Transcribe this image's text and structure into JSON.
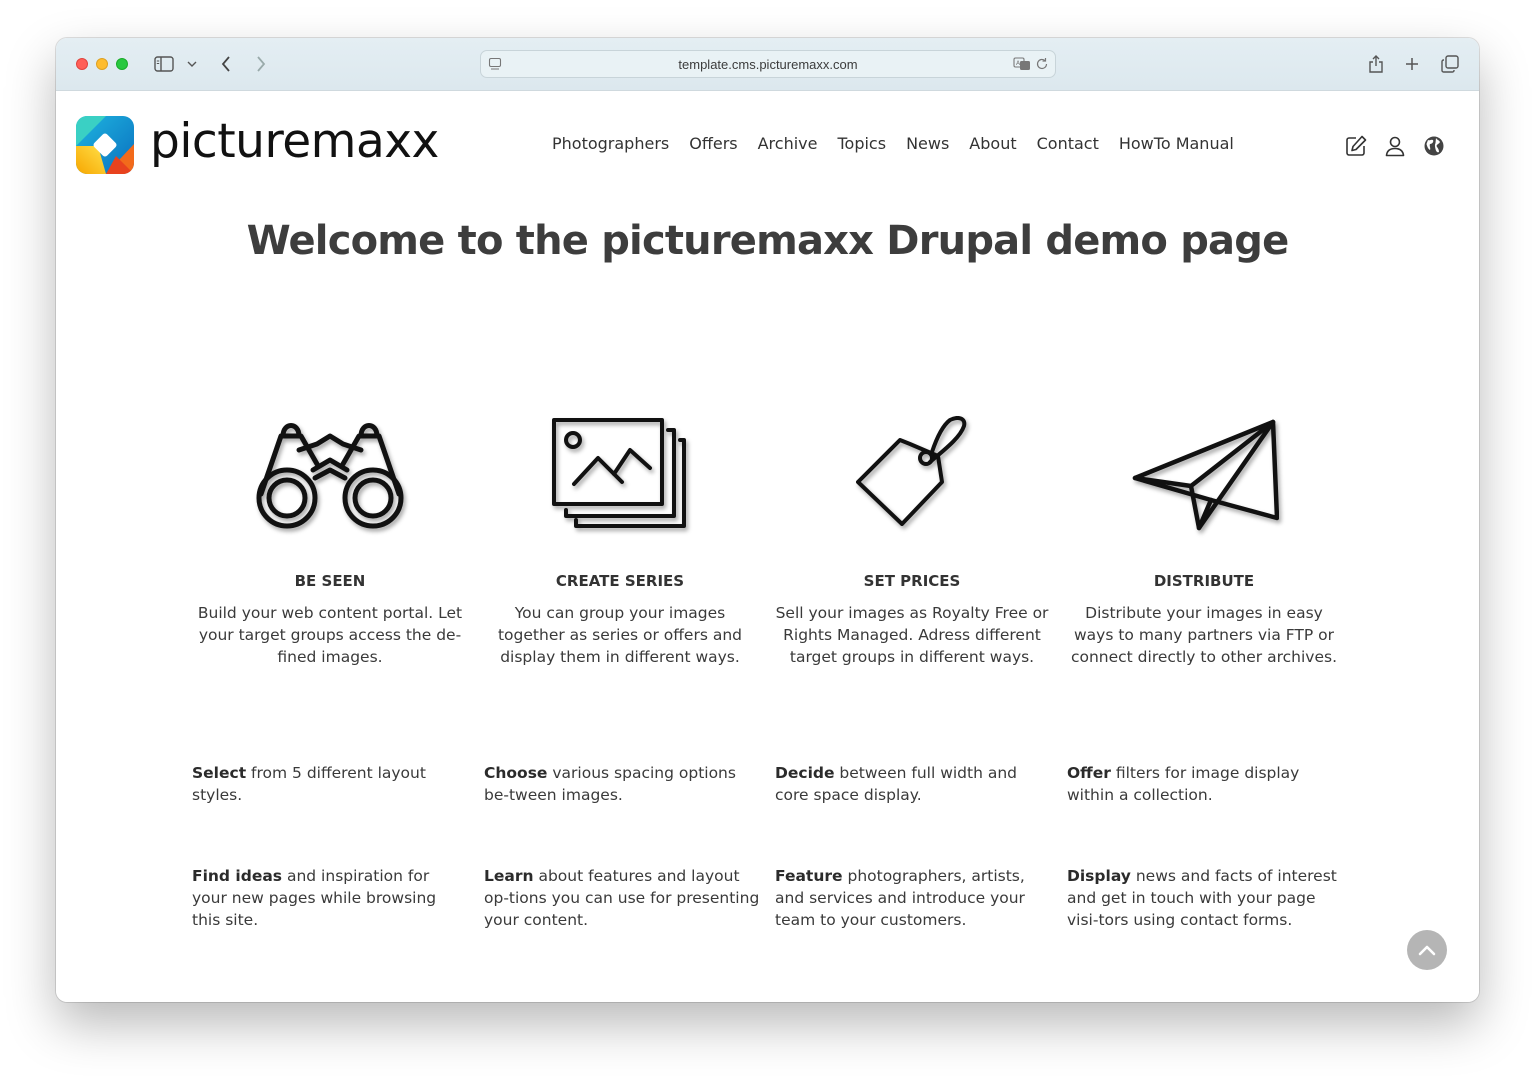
{
  "browser": {
    "url": "template.cms.picturemaxx.com"
  },
  "site": {
    "logo_text": "picturemaxx",
    "nav": [
      "Photographers",
      "Offers",
      "Archive",
      "Topics",
      "News",
      "About",
      "Contact",
      "HowTo Manual"
    ]
  },
  "main": {
    "heading": "Welcome to the picturemaxx Drupal demo page",
    "features": [
      {
        "icon": "binoculars-icon",
        "title": "BE SEEN",
        "text": "Build your web content portal. Let your target groups access the de-fined images."
      },
      {
        "icon": "image-stack-icon",
        "title": "CREATE SERIES",
        "text": "You can group your images together as series or offers and display them in different ways."
      },
      {
        "icon": "price-tag-icon",
        "title": "SET PRICES",
        "text": "Sell your images as Royalty Free or Rights Managed. Adress different target groups in different ways."
      },
      {
        "icon": "paper-plane-icon",
        "title": "DISTRIBUTE",
        "text": "Distribute your images in easy ways to many partners via FTP or connect directly to other archives."
      }
    ],
    "bullet_rows": [
      [
        {
          "bold": "Select",
          "rest": " from 5 different layout styles."
        },
        {
          "bold": "Choose",
          "rest": " various spacing options be-tween images."
        },
        {
          "bold": "Decide",
          "rest": " between full width and core space display."
        },
        {
          "bold": "Offer",
          "rest": " filters for image display within a collection."
        }
      ],
      [
        {
          "bold": "Find ideas",
          "rest": " and inspiration for your new pages while browsing this site."
        },
        {
          "bold": "Learn",
          "rest": " about features and layout op-tions you can use for presenting your content."
        },
        {
          "bold": "Feature",
          "rest": " photographers, artists, and services and introduce your team to your customers."
        },
        {
          "bold": "Display",
          "rest": " news and facts of interest and get in touch with your page visi-tors using contact forms."
        }
      ]
    ]
  }
}
